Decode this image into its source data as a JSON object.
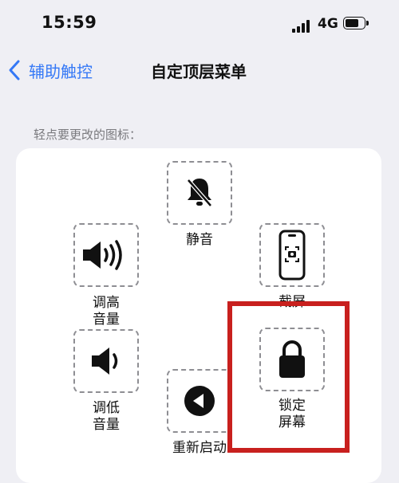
{
  "status_bar": {
    "time": "15:59",
    "network": "4G"
  },
  "nav": {
    "back_label": "辅助触控",
    "title": "自定顶层菜单"
  },
  "instruction": "轻点要更改的图标：",
  "menu_items": [
    {
      "label": "静音",
      "icon": "bell-slash-icon"
    },
    {
      "label": "截屏",
      "icon": "screenshot-icon"
    },
    {
      "label": "调高\n音量",
      "line1": "调高",
      "line2": "音量",
      "icon": "volume-up-icon"
    },
    {
      "label": "调低\n音量",
      "line1": "调低",
      "line2": "音量",
      "icon": "volume-down-icon"
    },
    {
      "label": "锁定\n屏幕",
      "line1": "锁定",
      "line2": "屏幕",
      "icon": "lock-icon"
    },
    {
      "label": "重新启动",
      "icon": "restart-icon"
    }
  ],
  "colors": {
    "accent": "#3478f6",
    "highlight": "#c8201e",
    "background": "#efeff4"
  }
}
